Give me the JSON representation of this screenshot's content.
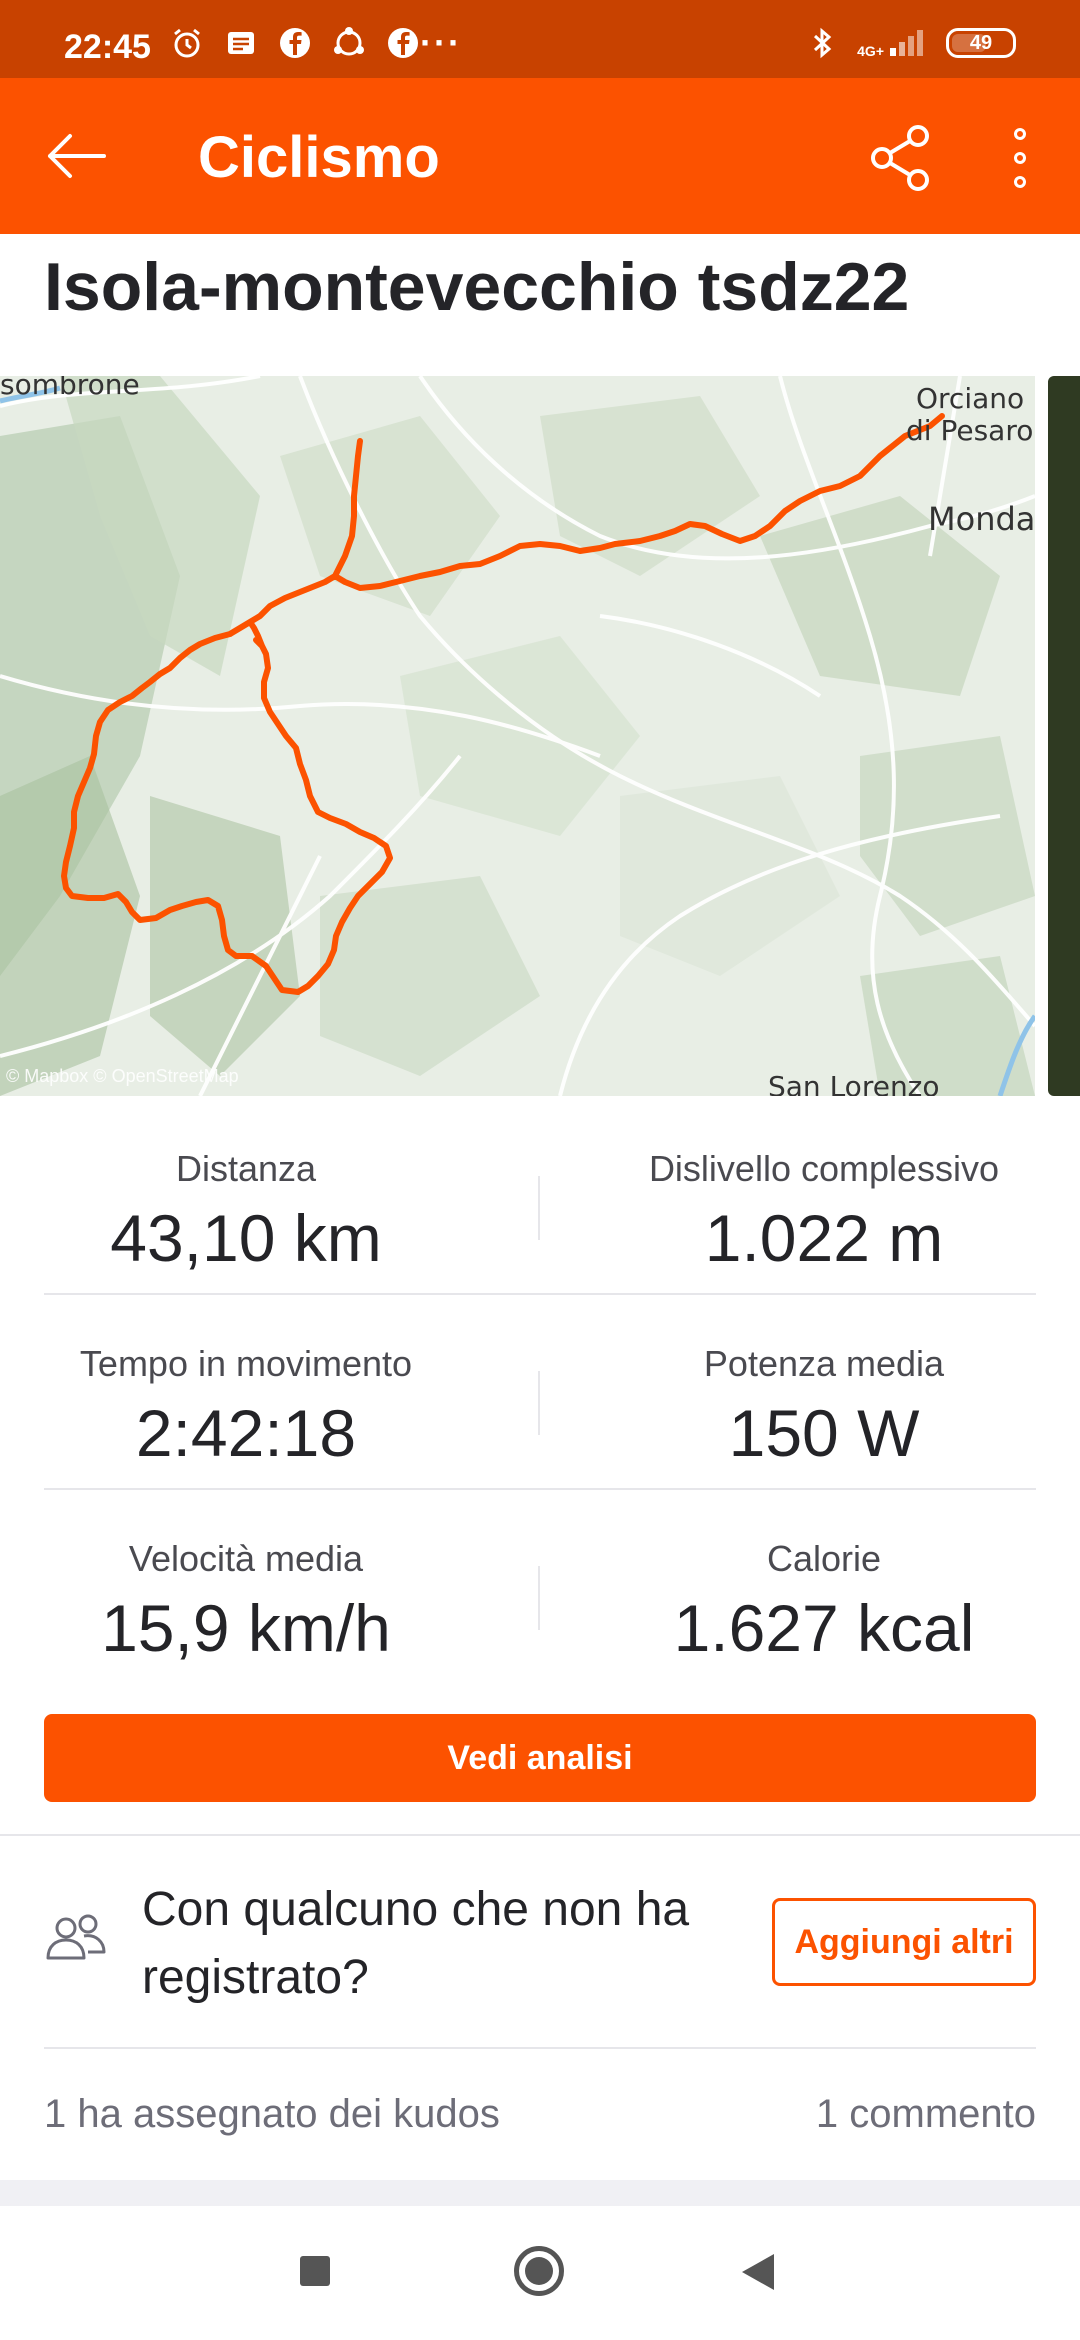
{
  "status_bar": {
    "time": "22:45",
    "network": "4G+",
    "battery": "49",
    "icons": [
      "alarm-icon",
      "notification-icon",
      "facebook-icon",
      "sync-icon",
      "facebook-icon",
      "more-dots-icon",
      "bluetooth-icon",
      "signal-icon",
      "battery-icon"
    ]
  },
  "app_bar": {
    "title": "Ciclismo",
    "back_icon": "arrow-left-icon",
    "share_icon": "share-icon",
    "more_icon": "more-vertical-icon",
    "color": "#fc5200"
  },
  "activity": {
    "title": "Isola-montevecchio tsdz22"
  },
  "map": {
    "labels": {
      "top_left": "sombrone",
      "orciano_1": "Orciano",
      "orciano_2": "di Pesaro",
      "mondavio": "Mondav",
      "san_lorenzo": "San Lorenzo"
    },
    "attribution": "© Mapbox © OpenStreetMap",
    "route_color": "#fc5200"
  },
  "stats": [
    {
      "label": "Distanza",
      "value": "43,10 km"
    },
    {
      "label": "Dislivello complessivo",
      "value": "1.022 m"
    },
    {
      "label": "Tempo in movimento",
      "value": "2:42:18"
    },
    {
      "label": "Potenza media",
      "value": "150 W"
    },
    {
      "label": "Velocità media",
      "value": "15,9 km/h"
    },
    {
      "label": "Calorie",
      "value": "1.627 kcal"
    }
  ],
  "analysis_button": "Vedi analisi",
  "add_others": {
    "prompt": "Con qualcuno che non ha registrato?",
    "button": "Aggiungi altri",
    "icon": "people-icon"
  },
  "social": {
    "kudos": "1 ha assegnato dei kudos",
    "comments": "1 commento"
  },
  "nav_bar": {
    "icons": [
      "recents-icon",
      "home-icon",
      "back-icon"
    ]
  }
}
